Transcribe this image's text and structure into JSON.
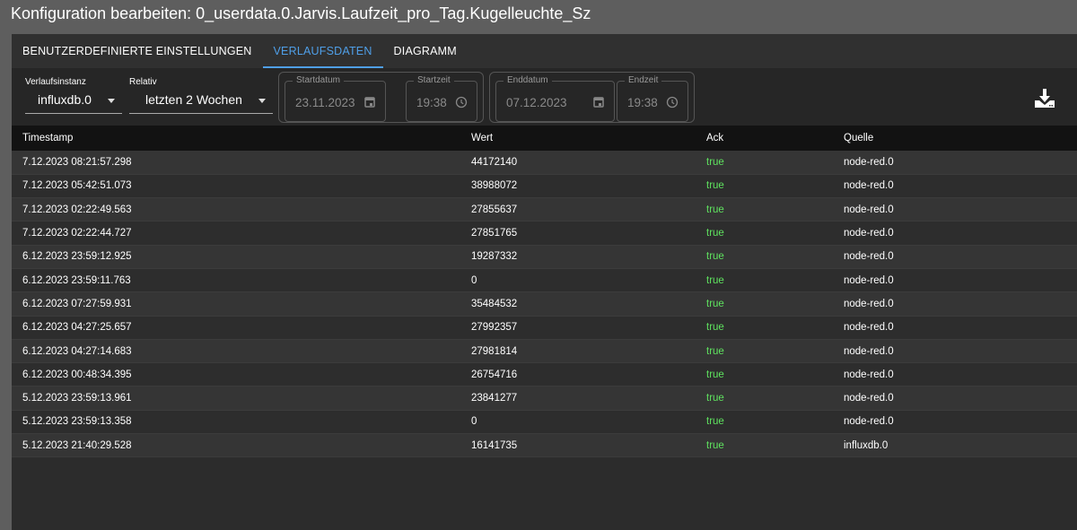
{
  "title": "Konfiguration bearbeiten: 0_userdata.0.Jarvis.Laufzeit_pro_Tag.Kugelleuchte_Sz",
  "tabs": [
    {
      "label": "BENUTZERDEFINIERTE EINSTELLUNGEN"
    },
    {
      "label": "VERLAUFSDATEN"
    },
    {
      "label": "DIAGRAMM"
    }
  ],
  "controls": {
    "instance": {
      "label": "Verlaufsinstanz",
      "value": "influxdb.0"
    },
    "relative": {
      "label": "Relativ",
      "value": "letzten 2 Wochen"
    },
    "start_date": {
      "label": "Startdatum",
      "value": "23.11.2023"
    },
    "start_time": {
      "label": "Startzeit",
      "value": "19:38"
    },
    "end_date": {
      "label": "Enddatum",
      "value": "07.12.2023"
    },
    "end_time": {
      "label": "Endzeit",
      "value": "19:38"
    },
    "download_icon": "download-icon"
  },
  "table": {
    "headers": [
      "Timestamp",
      "Wert",
      "Ack",
      "Quelle"
    ],
    "rows": [
      [
        "7.12.2023 08:21:57.298",
        "44172140",
        "true",
        "node-red.0"
      ],
      [
        "7.12.2023 05:42:51.073",
        "38988072",
        "true",
        "node-red.0"
      ],
      [
        "7.12.2023 02:22:49.563",
        "27855637",
        "true",
        "node-red.0"
      ],
      [
        "7.12.2023 02:22:44.727",
        "27851765",
        "true",
        "node-red.0"
      ],
      [
        "6.12.2023 23:59:12.925",
        "19287332",
        "true",
        "node-red.0"
      ],
      [
        "6.12.2023 23:59:11.763",
        "0",
        "true",
        "node-red.0"
      ],
      [
        "6.12.2023 07:27:59.931",
        "35484532",
        "true",
        "node-red.0"
      ],
      [
        "6.12.2023 04:27:25.657",
        "27992357",
        "true",
        "node-red.0"
      ],
      [
        "6.12.2023 04:27:14.683",
        "27981814",
        "true",
        "node-red.0"
      ],
      [
        "6.12.2023 00:48:34.395",
        "26754716",
        "true",
        "node-red.0"
      ],
      [
        "5.12.2023 23:59:13.961",
        "23841277",
        "true",
        "node-red.0"
      ],
      [
        "5.12.2023 23:59:13.358",
        "0",
        "true",
        "node-red.0"
      ],
      [
        "5.12.2023 21:40:29.528",
        "16141735",
        "true",
        "influxdb.0"
      ]
    ]
  }
}
